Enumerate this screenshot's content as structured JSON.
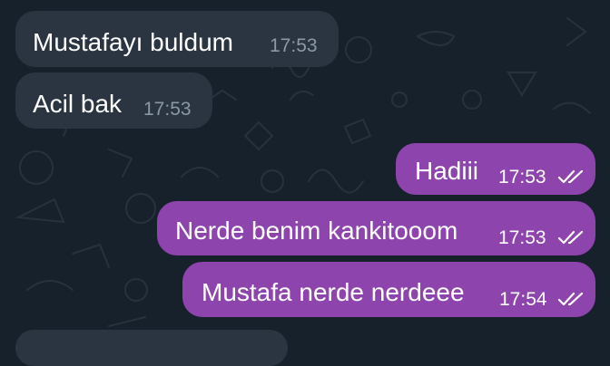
{
  "messages": [
    {
      "direction": "incoming",
      "text": "Mustafayı buldum",
      "time": "17:53"
    },
    {
      "direction": "incoming",
      "text": "Acil bak",
      "time": "17:53"
    },
    {
      "direction": "outgoing",
      "text": "Hadiii",
      "time": "17:53",
      "status": "read"
    },
    {
      "direction": "outgoing",
      "text": "Nerde benim kankitooom",
      "time": "17:53",
      "status": "read"
    },
    {
      "direction": "outgoing",
      "text": "Mustafa nerde nerdeee",
      "time": "17:54",
      "status": "read"
    }
  ],
  "colors": {
    "background": "#17212b",
    "incoming_bubble": "#2a3541",
    "outgoing_bubble": "#8e44ad",
    "incoming_time": "#8b98a5",
    "text": "#ffffff"
  },
  "icons": {
    "read_receipt": "double-check-icon",
    "wallpaper": "doodle-pattern"
  }
}
